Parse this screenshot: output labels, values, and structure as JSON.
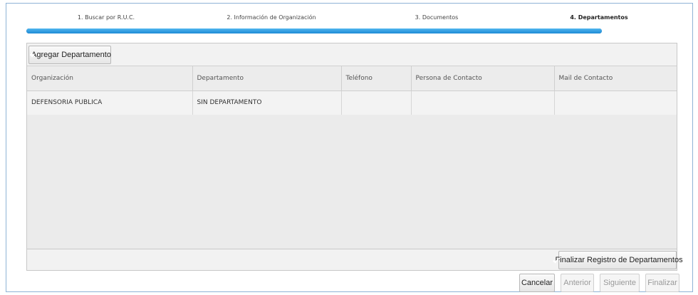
{
  "wizard": {
    "steps": [
      {
        "label": "1. Buscar por R.U.C.",
        "active": false
      },
      {
        "label": "2. Información de Organización",
        "active": false
      },
      {
        "label": "3. Documentos",
        "active": false
      },
      {
        "label": "4. Departamentos",
        "active": true
      }
    ],
    "progress": 1.0,
    "progress_color": "#1e8ad6"
  },
  "toolbar": {
    "add_label": "Agregar Departamento",
    "add_icon": "plus-square-icon"
  },
  "table": {
    "columns": [
      "Organización",
      "Departamento",
      "Teléfono",
      "Persona de Contacto",
      "Mail de Contacto"
    ],
    "rows": [
      [
        "DEFENSORIA PUBLICA",
        "SIN DEPARTAMENTO",
        "",
        "",
        ""
      ]
    ]
  },
  "footer": {
    "finalize_registration_label": "Finalizar Registro de Departamentos",
    "finalize_icon": "checkbox-checked-icon"
  },
  "actions": {
    "cancel_label": "Cancelar",
    "prev_label": "Anterior",
    "next_label": "Siguiente",
    "finish_label": "Finalizar"
  }
}
